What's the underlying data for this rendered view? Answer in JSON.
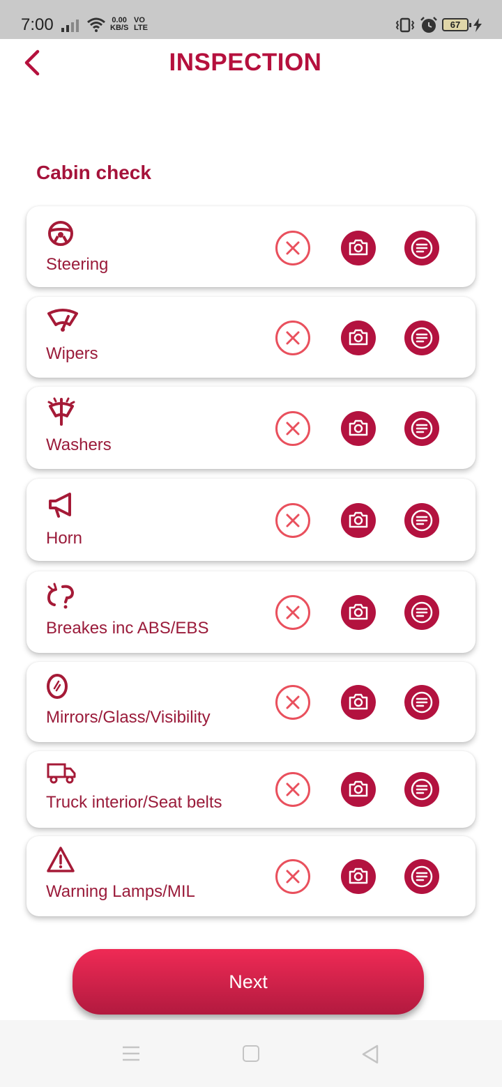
{
  "status_bar": {
    "time": "7:00",
    "net_speed_value": "0.00",
    "net_speed_unit": "KB/S",
    "network_label_top": "VO",
    "network_label_bottom": "LTE",
    "battery": "67"
  },
  "header": {
    "title": "INSPECTION"
  },
  "section": {
    "title": "Cabin check"
  },
  "items": [
    {
      "label": "Steering",
      "icon": "steering-wheel-icon"
    },
    {
      "label": "Wipers",
      "icon": "wiper-icon"
    },
    {
      "label": "Washers",
      "icon": "washer-icon"
    },
    {
      "label": "Horn",
      "icon": "horn-icon"
    },
    {
      "label": "Breakes inc ABS/EBS",
      "icon": "brake-icon"
    },
    {
      "label": "Mirrors/Glass/Visibility",
      "icon": "mirror-icon"
    },
    {
      "label": "Truck interior/Seat belts",
      "icon": "truck-icon"
    },
    {
      "label": "Warning Lamps/MIL",
      "icon": "warning-icon"
    }
  ],
  "actions": {
    "next_label": "Next"
  },
  "colors": {
    "accent": "#b3123f",
    "fail": "#e9505d",
    "label": "#9a1b3a"
  }
}
